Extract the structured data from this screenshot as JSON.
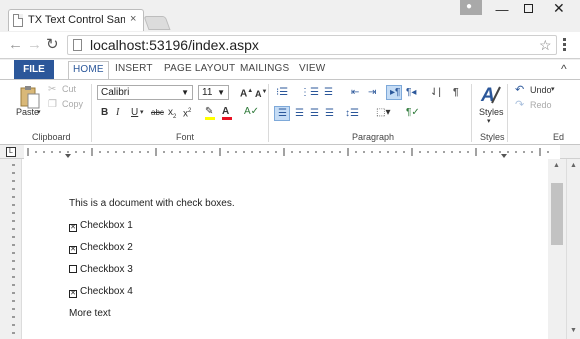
{
  "browser": {
    "tab_title": "TX Text Control Sample: U",
    "tab_close": "×",
    "url": "localhost:53196/index.aspx",
    "icons": [
      "back-arrow-icon",
      "forward-arrow-icon",
      "reload-icon",
      "page-icon",
      "star-icon",
      "menu-icon",
      "user-icon",
      "minimize-icon",
      "maximize-icon",
      "close-icon"
    ]
  },
  "ribbon": {
    "tabs": [
      "FILE",
      "HOME",
      "INSERT",
      "PAGE LAYOUT",
      "MAILINGS",
      "VIEW"
    ],
    "clipboard": {
      "paste": "Paste",
      "cut": "Cut",
      "copy": "Copy",
      "label": "Clipboard"
    },
    "font": {
      "family": "Calibri",
      "size": "11",
      "label": "Font"
    },
    "paragraph": {
      "label": "Paragraph"
    },
    "styles": {
      "button": "Styles",
      "label": "Styles"
    },
    "editing": {
      "undo": "Undo",
      "redo": "Redo",
      "label": "Ed"
    }
  },
  "document": {
    "lines": [
      {
        "text": "This is a document with check boxes.",
        "checkbox": null
      },
      {
        "text": "Checkbox 1",
        "checkbox": "checked"
      },
      {
        "text": "Checkbox 2",
        "checkbox": "checked"
      },
      {
        "text": "Checkbox 3",
        "checkbox": "unchecked"
      },
      {
        "text": "Checkbox 4",
        "checkbox": "checked"
      },
      {
        "text": "More text",
        "checkbox": null
      }
    ]
  },
  "colors": {
    "file_tab": "#2b579a",
    "accent": "#2b579a",
    "highlight": "#ffff00",
    "font_color": "#e81123"
  }
}
